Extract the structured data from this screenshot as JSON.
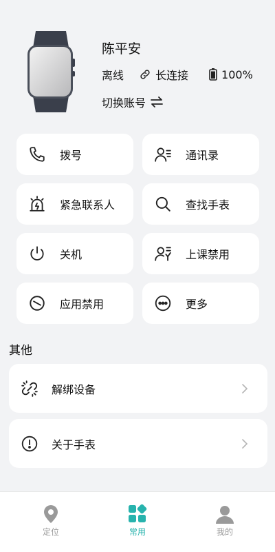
{
  "device": {
    "name": "陈平安",
    "status": "离线",
    "connection": "长连接",
    "battery": "100%",
    "switch_label": "切换账号"
  },
  "grid": [
    {
      "label": "拨号",
      "icon": "phone-icon"
    },
    {
      "label": "通讯录",
      "icon": "contacts-icon"
    },
    {
      "label": "紧急联系人",
      "icon": "alarm-light-icon"
    },
    {
      "label": "查找手表",
      "icon": "search-icon"
    },
    {
      "label": "关机",
      "icon": "power-icon"
    },
    {
      "label": "上课禁用",
      "icon": "class-disable-icon"
    },
    {
      "label": "应用禁用",
      "icon": "app-disable-icon"
    },
    {
      "label": "更多",
      "icon": "more-icon"
    }
  ],
  "other": {
    "title": "其他",
    "items": [
      {
        "label": "解绑设备",
        "icon": "unlink-icon"
      },
      {
        "label": "关于手表",
        "icon": "info-icon"
      }
    ]
  },
  "tabs": [
    {
      "label": "定位",
      "icon": "location-pin-icon",
      "active": false
    },
    {
      "label": "常用",
      "icon": "grid-apps-icon",
      "active": true
    },
    {
      "label": "我的",
      "icon": "person-icon",
      "active": false
    }
  ],
  "colors": {
    "accent": "#27b3ad",
    "inactive": "#9a9a9a",
    "background": "#f2f3f5"
  }
}
